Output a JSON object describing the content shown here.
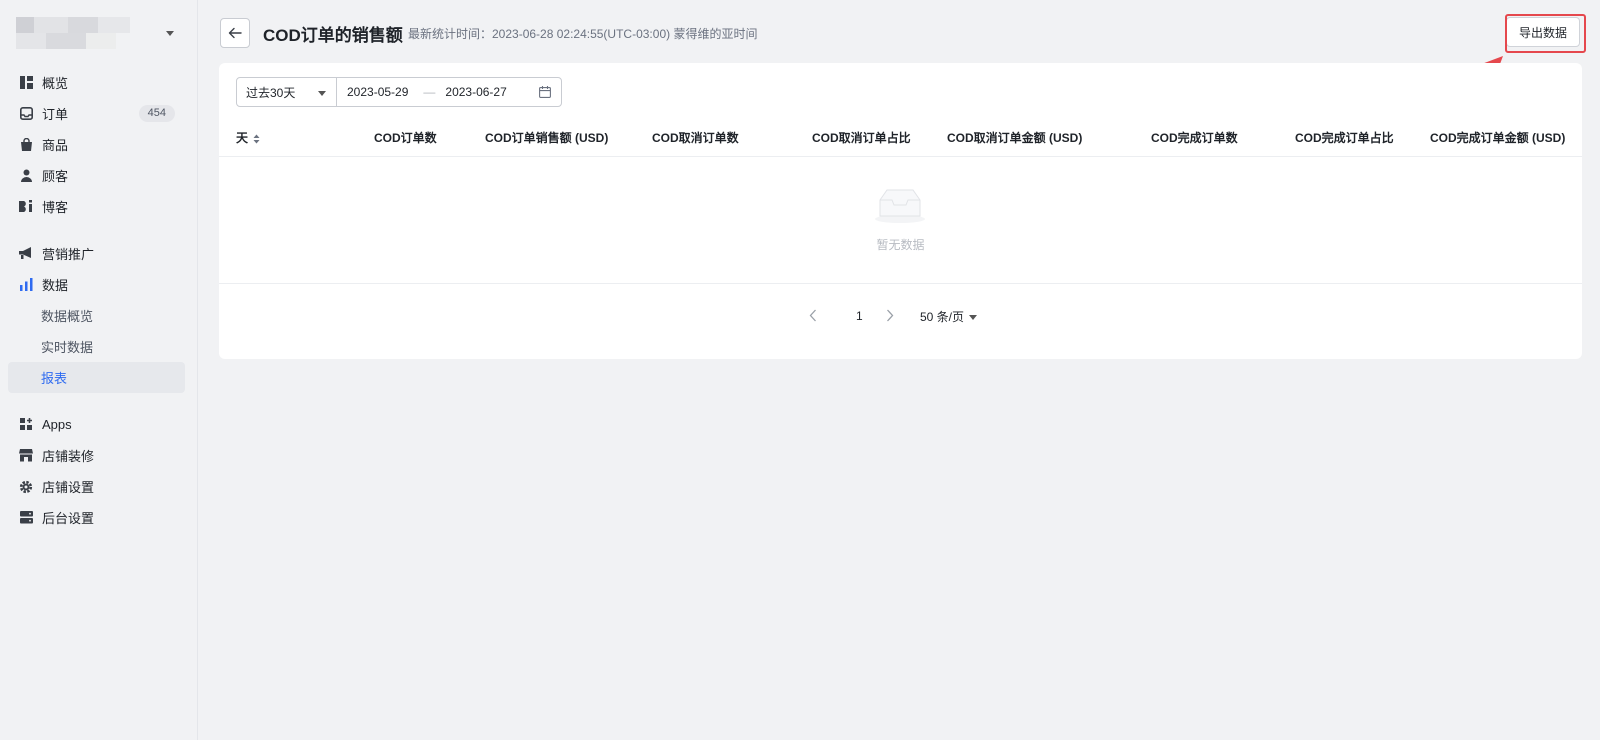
{
  "header": {
    "title": "COD订单的销售额",
    "stat_time": "最新统计时间：2023-06-28 02:24:55(UTC-03:00) 蒙得维的亚时间",
    "export_label": "导出数据"
  },
  "sidebar": {
    "items": [
      {
        "label": "概览",
        "icon": "dashboard-icon"
      },
      {
        "label": "订单",
        "icon": "inbox-icon",
        "badge": "454"
      },
      {
        "label": "商品",
        "icon": "bag-icon"
      },
      {
        "label": "顾客",
        "icon": "user-icon"
      },
      {
        "label": "博客",
        "icon": "blog-icon"
      },
      {
        "label": "营销推广",
        "icon": "megaphone-icon"
      },
      {
        "label": "数据",
        "icon": "bar-chart-icon"
      },
      {
        "label": "数据概览"
      },
      {
        "label": "实时数据"
      },
      {
        "label": "报表"
      },
      {
        "label": "Apps",
        "icon": "apps-icon"
      },
      {
        "label": "店铺装修",
        "icon": "store-icon"
      },
      {
        "label": "店铺设置",
        "icon": "gear-icon"
      },
      {
        "label": "后台设置",
        "icon": "server-icon"
      }
    ]
  },
  "filters": {
    "range_label": "过去30天",
    "start_date": "2023-05-29",
    "end_date": "2023-06-27",
    "separator": "—"
  },
  "table": {
    "columns": [
      "天",
      "COD订单数",
      "COD订单销售额 (USD)",
      "COD取消订单数",
      "COD取消订单占比",
      "COD取消订单金额 (USD)",
      "COD完成订单数",
      "COD完成订单占比",
      "COD完成订单金额 (USD)"
    ],
    "empty_text": "暂无数据"
  },
  "pagination": {
    "page": "1",
    "page_size": "50 条/页"
  },
  "colors": {
    "accent": "#2f6bf0",
    "highlight": "#e5484d"
  }
}
